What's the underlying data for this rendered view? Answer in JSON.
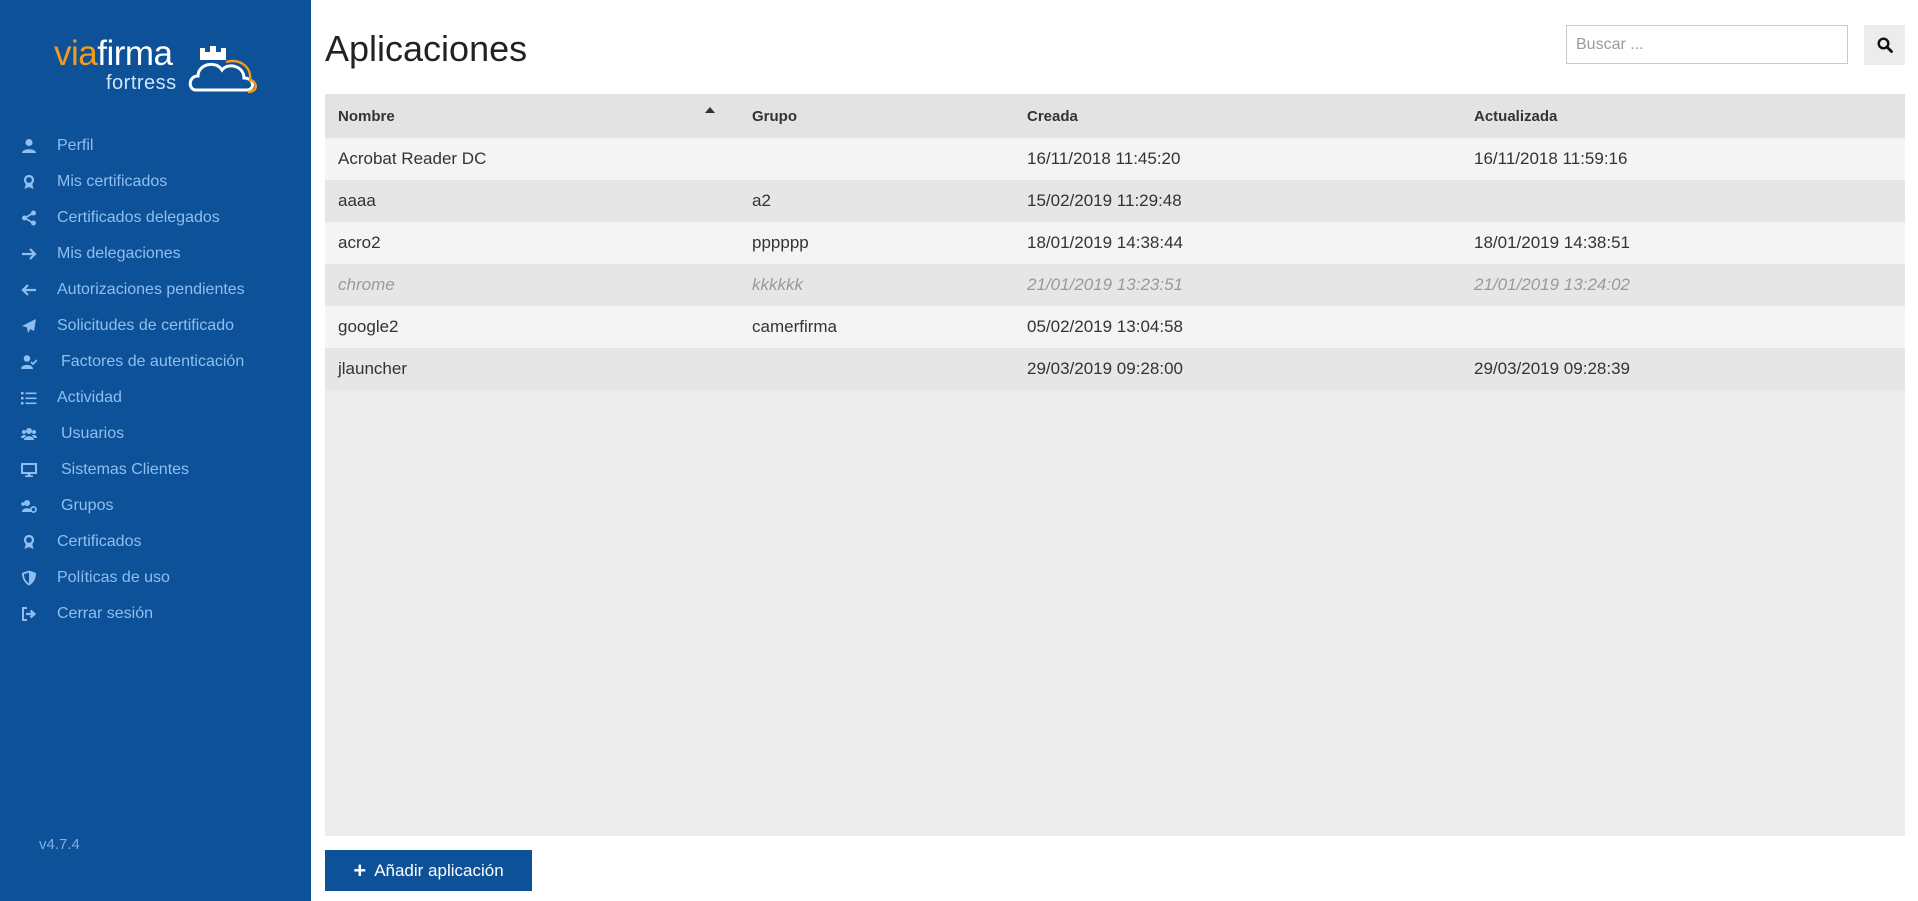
{
  "brand": {
    "name_part1": "via",
    "name_part2": "firma",
    "product": "fortress",
    "accent_color": "#f29b1d",
    "sidebar_color": "#0d5199"
  },
  "sidebar": {
    "items": [
      {
        "label": "Perfil",
        "icon": "user-icon"
      },
      {
        "label": "Mis certificados",
        "icon": "award-icon"
      },
      {
        "label": "Certificados delegados",
        "icon": "share-icon"
      },
      {
        "label": "Mis delegaciones",
        "icon": "arrow-right-icon"
      },
      {
        "label": "Autorizaciones pendientes",
        "icon": "arrow-left-icon"
      },
      {
        "label": "Solicitudes de certificado",
        "icon": "paper-plane-icon"
      },
      {
        "label": "Factores de autenticación",
        "icon": "user-check-icon"
      },
      {
        "label": "Actividad",
        "icon": "list-icon"
      },
      {
        "label": "Usuarios",
        "icon": "users-icon"
      },
      {
        "label": "Sistemas Clientes",
        "icon": "desktop-icon"
      },
      {
        "label": "Grupos",
        "icon": "users-cog-icon"
      },
      {
        "label": "Certificados",
        "icon": "award-icon"
      },
      {
        "label": "Políticas de uso",
        "icon": "shield-icon"
      },
      {
        "label": "Cerrar sesión",
        "icon": "sign-out-icon"
      }
    ],
    "version": "v4.7.4"
  },
  "main": {
    "title": "Aplicaciones",
    "search": {
      "placeholder": "Buscar ...",
      "value": ""
    },
    "table": {
      "columns": [
        "Nombre",
        "Grupo",
        "Creada",
        "Actualizada"
      ],
      "sort_column": "Nombre",
      "sort_direction": "asc",
      "rows": [
        {
          "nombre": "Acrobat Reader DC",
          "grupo": "",
          "creada": "16/11/2018 11:45:20",
          "actualizada": "16/11/2018 11:59:16",
          "disabled": false
        },
        {
          "nombre": "aaaa",
          "grupo": "a2",
          "creada": "15/02/2019 11:29:48",
          "actualizada": "",
          "disabled": false
        },
        {
          "nombre": "acro2",
          "grupo": "pppppp",
          "creada": "18/01/2019 14:38:44",
          "actualizada": "18/01/2019 14:38:51",
          "disabled": false
        },
        {
          "nombre": "chrome",
          "grupo": "kkkkkk",
          "creada": "21/01/2019 13:23:51",
          "actualizada": "21/01/2019 13:24:02",
          "disabled": true
        },
        {
          "nombre": "google2",
          "grupo": "camerfirma",
          "creada": "05/02/2019 13:04:58",
          "actualizada": "",
          "disabled": false
        },
        {
          "nombre": "jlauncher",
          "grupo": "",
          "creada": "29/03/2019 09:28:00",
          "actualizada": "29/03/2019 09:28:39",
          "disabled": false
        }
      ]
    },
    "add_button": "Añadir aplicación"
  }
}
